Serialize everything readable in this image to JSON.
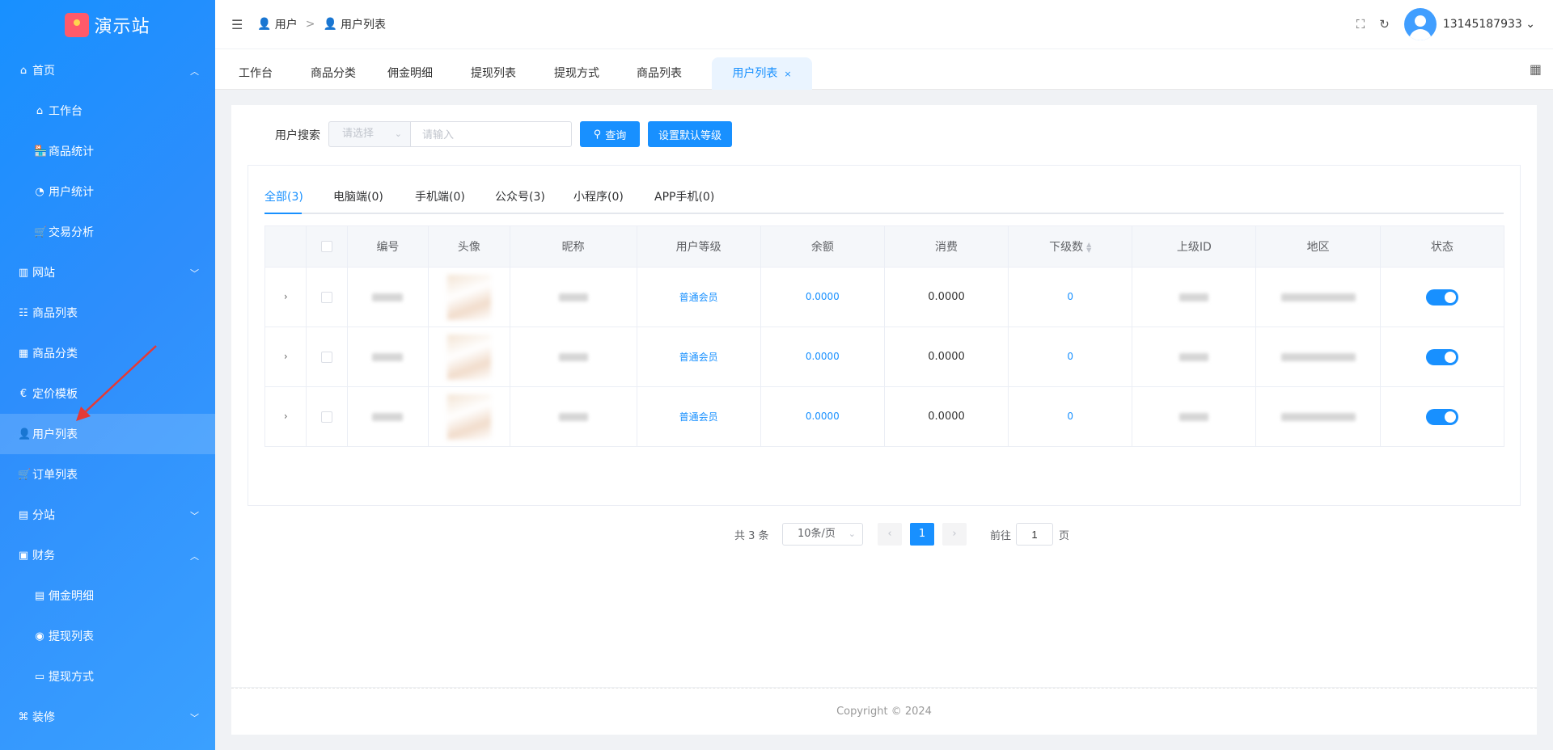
{
  "logo": {
    "text": "演示站"
  },
  "sidebar": {
    "items": [
      {
        "label": "首页",
        "icon": "home-icon",
        "level": 0,
        "chevron": "up"
      },
      {
        "label": "工作台",
        "icon": "home-icon",
        "level": 1
      },
      {
        "label": "商品统计",
        "icon": "store-icon",
        "level": 1
      },
      {
        "label": "用户统计",
        "icon": "pie-chart-icon",
        "level": 1
      },
      {
        "label": "交易分析",
        "icon": "cart-icon",
        "level": 1
      },
      {
        "label": "网站",
        "icon": "chart-icon",
        "level": 0,
        "chevron": "down"
      },
      {
        "label": "商品列表",
        "icon": "list-icon",
        "level": 0
      },
      {
        "label": "商品分类",
        "icon": "grid-icon",
        "level": 0
      },
      {
        "label": "定价模板",
        "icon": "price-icon",
        "level": 0
      },
      {
        "label": "用户列表",
        "icon": "user-icon",
        "level": 0,
        "active": true
      },
      {
        "label": "订单列表",
        "icon": "cart-icon",
        "level": 0
      },
      {
        "label": "分站",
        "icon": "shop-icon",
        "level": 0,
        "chevron": "down"
      },
      {
        "label": "财务",
        "icon": "wallet-icon",
        "level": 0,
        "chevron": "up"
      },
      {
        "label": "佣金明细",
        "icon": "document-icon",
        "level": 1
      },
      {
        "label": "提现列表",
        "icon": "target-icon",
        "level": 1
      },
      {
        "label": "提现方式",
        "icon": "book-icon",
        "level": 1
      },
      {
        "label": "装修",
        "icon": "brush-icon",
        "level": 0,
        "chevron": "down"
      }
    ]
  },
  "header": {
    "breadcrumb": [
      "用户",
      "用户列表"
    ],
    "username": "13145187933"
  },
  "nav_tabs": [
    {
      "label": "工作台"
    },
    {
      "label": "商品分类"
    },
    {
      "label": "佣金明细"
    },
    {
      "label": "提现列表"
    },
    {
      "label": "提现方式"
    },
    {
      "label": "商品列表"
    },
    {
      "label": "用户列表",
      "active": true
    }
  ],
  "search": {
    "label": "用户搜索",
    "select_placeholder": "请选择",
    "input_placeholder": "请输入",
    "query_button": "查询",
    "default_level_button": "设置默认等级"
  },
  "filter_tabs": [
    {
      "label": "全部(3)",
      "active": true
    },
    {
      "label": "电脑端(0)"
    },
    {
      "label": "手机端(0)"
    },
    {
      "label": "公众号(3)"
    },
    {
      "label": "小程序(0)"
    },
    {
      "label": "APP手机(0)"
    }
  ],
  "table": {
    "columns": [
      "编号",
      "头像",
      "昵称",
      "用户等级",
      "余额",
      "消费",
      "下级数",
      "上级ID",
      "地区",
      "状态"
    ],
    "rows": [
      {
        "level": "普通会员",
        "balance": "0.0000",
        "consume": "0.0000",
        "children": "0",
        "status": true
      },
      {
        "level": "普通会员",
        "balance": "0.0000",
        "consume": "0.0000",
        "children": "0",
        "status": true
      },
      {
        "level": "普通会员",
        "balance": "0.0000",
        "consume": "0.0000",
        "children": "0",
        "status": true
      }
    ]
  },
  "pagination": {
    "total": "共 3 条",
    "page_size": "10条/页",
    "current": "1",
    "goto_label": "前往",
    "goto_value": "1",
    "goto_unit": "页"
  },
  "footer": {
    "text": "Copyright © 2024"
  },
  "colors": {
    "primary": "#1890ff",
    "sidebar": "#2e8efc",
    "annotation": "#e53935"
  }
}
